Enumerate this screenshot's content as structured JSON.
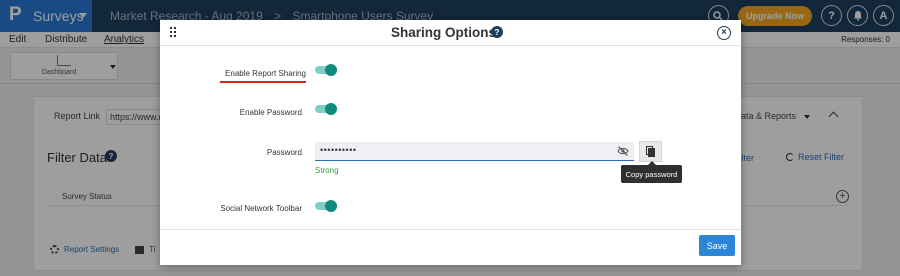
{
  "topbar": {
    "logo_letter": "P",
    "product": "Surveys",
    "breadcrumb": [
      "Market Research - Aug 2019",
      ">",
      "Smartphone Users Survey"
    ],
    "upgrade_label": "Upgrade Now",
    "help_glyph": "?",
    "avatar_letter": "A",
    "colors": {
      "bar": "#1f3f5e",
      "logo": "#2b78d6",
      "upgrade": "#f5a623"
    }
  },
  "nav": {
    "items": [
      "Edit",
      "Distribute",
      "Analytics"
    ],
    "active": "Analytics",
    "responses": "Responses: 0"
  },
  "subbar": {
    "dashboard_label": "Dashboard"
  },
  "background": {
    "report_link_label": "Report Link",
    "report_link_value": "https://www.q",
    "data_reports": "ata & Reports",
    "filter_title": "Filter Data",
    "filter_right": "Filter",
    "reset_filter": "Reset Filter",
    "survey_status": "Survey Status",
    "report_settings": "Report Settings",
    "tile_item": "Ti"
  },
  "modal": {
    "title": "Sharing Options",
    "close_glyph": "×",
    "fields": {
      "enable_report_sharing": {
        "label": "Enable Report Sharing",
        "on": true
      },
      "enable_password": {
        "label": "Enable Password",
        "on": true
      },
      "password": {
        "label": "Password",
        "value": "••••••••••",
        "strength": "Strong"
      },
      "social_network_toolbar": {
        "label": "Social Network Toolbar",
        "on": true
      }
    },
    "copy_tooltip": "Copy password",
    "save_label": "Save",
    "colors": {
      "toggle": "#0f8b7d",
      "accent": "#2b86d8",
      "strength": "#3a9b3a",
      "highlight": "#e02020"
    }
  }
}
